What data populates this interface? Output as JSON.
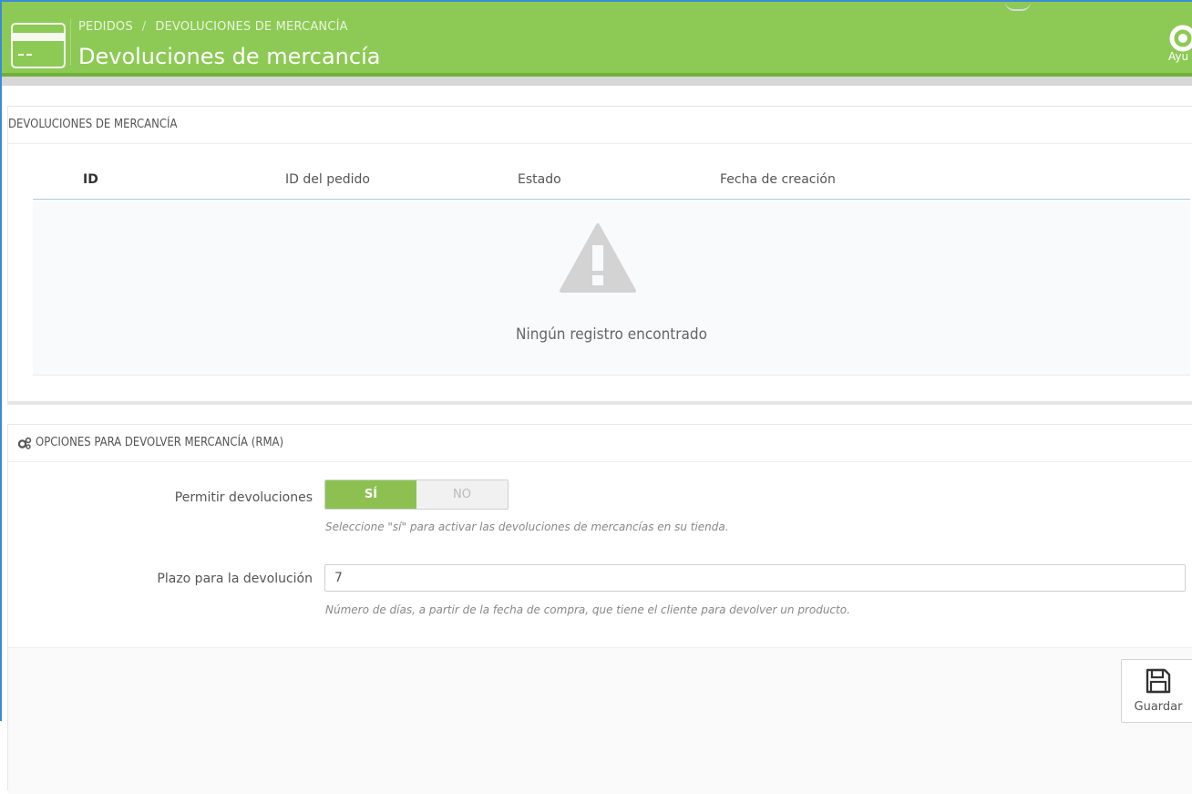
{
  "header": {
    "breadcrumb": [
      "PEDIDOS",
      "DEVOLUCIONES DE MERCANCÍA"
    ],
    "breadcrumb_separator": "/",
    "title": "Devoluciones de mercancía",
    "help_label": "Ayu",
    "brand_color": "#8dca55"
  },
  "returns_panel": {
    "heading": "DEVOLUCIONES DE MERCANCÍA",
    "columns": [
      "ID",
      "ID del pedido",
      "Estado",
      "Fecha de creación"
    ],
    "empty_icon": "warning-icon",
    "empty_message": "Ningún registro encontrado"
  },
  "options_panel": {
    "heading": "OPCIONES PARA DEVOLVER MERCANCÍA (RMA)",
    "heading_icon": "gears-icon",
    "allow_returns": {
      "label": "Permitir devoluciones",
      "yes": "SÍ",
      "no": "NO",
      "selected": "SÍ",
      "help": "Seleccione \"sí\" para activar las devoluciones de mercancías en su tienda."
    },
    "deadline": {
      "label": "Plazo para la devolución",
      "value": "7",
      "help": "Número de días, a partir de la fecha de compra, que tiene el cliente para devolver un producto."
    },
    "save_label": "Guardar",
    "save_icon": "floppy-disk-icon"
  }
}
